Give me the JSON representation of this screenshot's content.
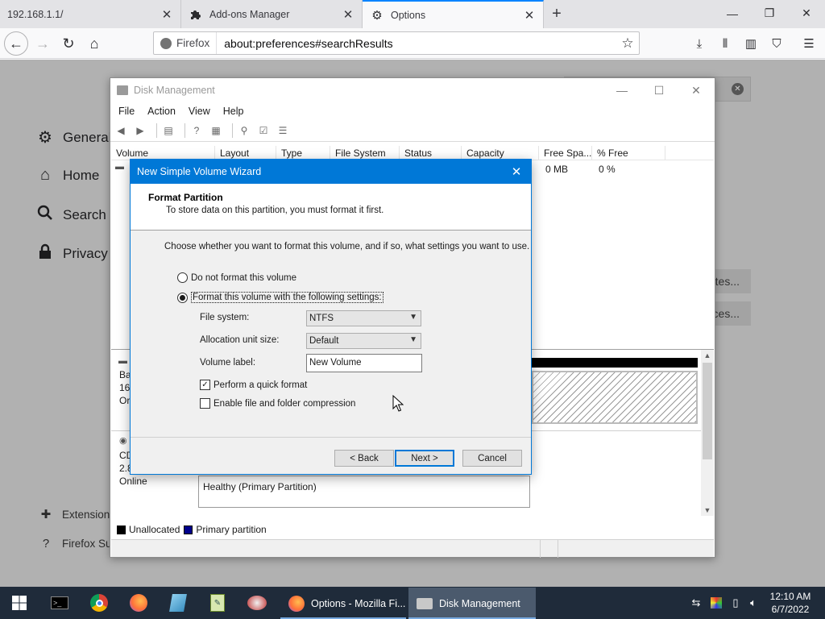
{
  "browser": {
    "tabs": [
      {
        "label": "192.168.1.1/"
      },
      {
        "label": "Add-ons Manager",
        "icon": "puzzle-icon"
      },
      {
        "label": "Options",
        "icon": "gear-icon"
      }
    ],
    "identity_label": "Firefox",
    "url": "about:preferences#searchResults"
  },
  "prefs": {
    "categories": [
      "General",
      "Home",
      "Search",
      "Privacy &"
    ],
    "footer": [
      "Extension",
      "Firefox Su"
    ],
    "button_fragments": [
      "tes...",
      "ces..."
    ]
  },
  "disk_mgmt": {
    "title": "Disk Management",
    "menu": [
      "File",
      "Action",
      "View",
      "Help"
    ],
    "columns": [
      "Volume",
      "Layout",
      "Type",
      "File System",
      "Status",
      "Capacity",
      "Free Spa...",
      "% Free"
    ],
    "row": {
      "free_space": "0 MB",
      "pct_free": "0 %"
    },
    "disk0_fragments": [
      "Ba",
      "16",
      "Or"
    ],
    "cdrom_fragments": [
      "CD",
      "2.8",
      "Online"
    ],
    "partition_status": "Healthy (Primary Partition)",
    "legend": [
      {
        "label": "Unallocated",
        "color": "#000000"
      },
      {
        "label": "Primary partition",
        "color": "#00008b"
      }
    ]
  },
  "wizard": {
    "title": "New Simple Volume Wizard",
    "header_title": "Format Partition",
    "header_sub": "To store data on this partition, you must format it first.",
    "intro": "Choose whether you want to format this volume, and if so, what settings you want to use.",
    "radio_no_format": "Do not format this volume",
    "radio_format": "Format this volume with the following settings:",
    "selected_option": "format",
    "file_system_label": "File system:",
    "file_system_value": "NTFS",
    "alloc_label": "Allocation unit size:",
    "alloc_value": "Default",
    "volume_label_label": "Volume label:",
    "volume_label_value": "New Volume",
    "quick_format_label": "Perform a quick format",
    "quick_format_checked": true,
    "compression_label": "Enable file and folder compression",
    "compression_checked": false,
    "back_label": "< Back",
    "next_label": "Next >",
    "cancel_label": "Cancel"
  },
  "taskbar": {
    "apps": [
      {
        "label": "Options - Mozilla Fi...",
        "active": false
      },
      {
        "label": "Disk Management",
        "active": true
      }
    ],
    "time": "12:10 AM",
    "date": "6/7/2022"
  },
  "colors": {
    "accent": "#0078d7",
    "firefox_tab_highlight": "#0a84ff",
    "taskbar_bg": "#1f2b3a"
  }
}
